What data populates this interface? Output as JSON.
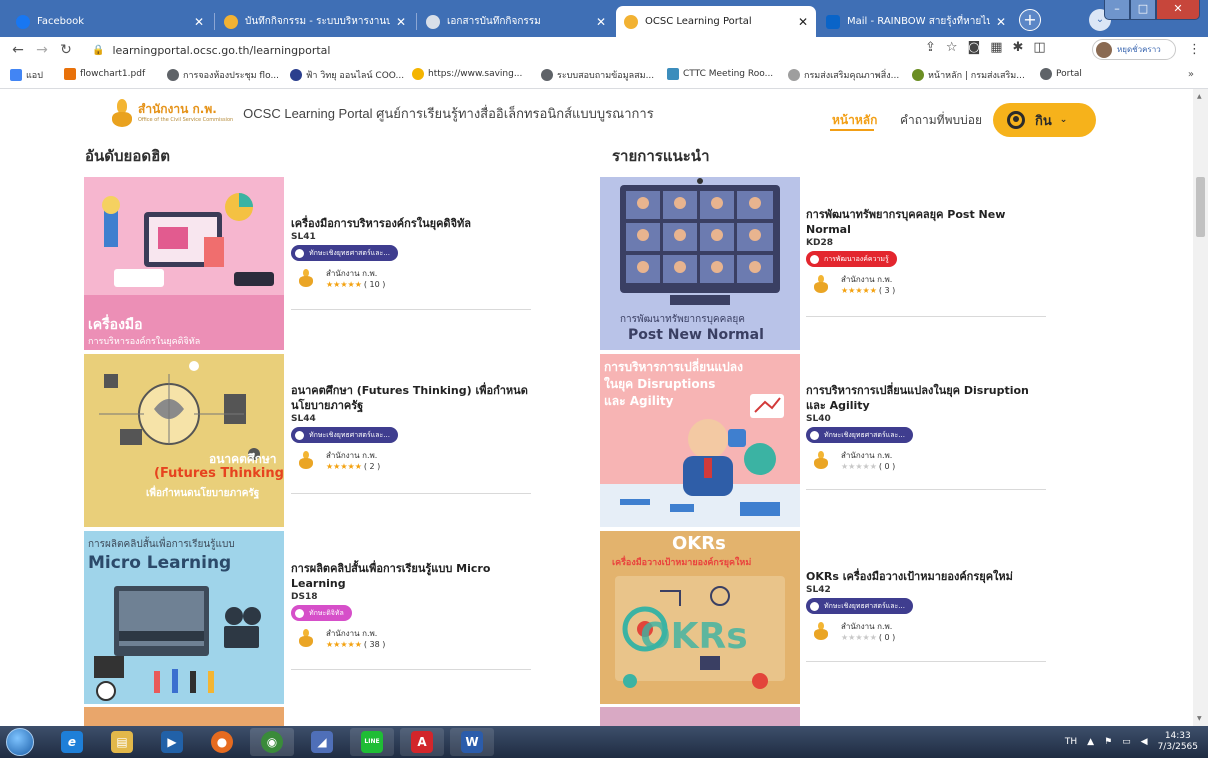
{
  "browser": {
    "tabs": [
      {
        "title": "Facebook",
        "color": "#1877f2"
      },
      {
        "title": "บันทึกกิจกรรม - ระบบบริหารงานบุคคล",
        "color": "#f2b233"
      },
      {
        "title": "เอกสารบันทึกกิจกรรม",
        "color": "#5f6368"
      },
      {
        "title": "OCSC Learning Portal",
        "color": "#f2b233"
      },
      {
        "title": "Mail - RAINBOW สายรุ้งที่หายไป - C",
        "color": "#0a64c8"
      }
    ],
    "url": "learningportal.ocsc.go.th/learningportal",
    "profile_label": "หยุดชั่วคราว",
    "bookmarks": [
      {
        "label": "แอป",
        "color": "#4285f4"
      },
      {
        "label": "flowchart1.pdf",
        "color": "#e8710a"
      },
      {
        "label": "การจองห้องประชุม flo...",
        "color": "#5f6368"
      },
      {
        "label": "ฟ้า วิทยุ ออนไลน์ COO...",
        "color": "#2b3f8e"
      },
      {
        "label": "https://www.saving...",
        "color": "#f4b400"
      },
      {
        "label": "ระบบสอบถามข้อมูลสม...",
        "color": "#5f6368"
      },
      {
        "label": "CTTC Meeting Roo...",
        "color": "#3c8dbc"
      },
      {
        "label": "กรมส่งเสริมคุณภาพสิ่ง...",
        "color": "#9e9e9e"
      },
      {
        "label": "หน้าหลัก | กรมส่งเสริม...",
        "color": "#6b8e23"
      },
      {
        "label": "Portal",
        "color": "#5f6368"
      }
    ]
  },
  "site": {
    "logo_text": "สำนักงาน ก.พ.",
    "logo_sub": "Office of the Civil Service Commission",
    "title": "OCSC Learning Portal ศูนย์การเรียนรู้ทางสื่ออิเล็กทรอนิกส์แบบบูรณาการ",
    "nav_home": "หน้าหลัก",
    "nav_faq": "คำถามที่พบบ่อย",
    "user_name": "กิน"
  },
  "sections": {
    "left_title": "อันดับยอดฮิต",
    "right_title": "รายการแนะนำ"
  },
  "left_courses": [
    {
      "title": "เครื่องมือการบริหารองค์กรในยุคดิจิทัล",
      "code": "SL41",
      "tag": "ทักษะเชิงยุทธศาสตร์และ...",
      "tag_color": "#3f3d8f",
      "org": "สำนักงาน ก.พ.",
      "rating": 5,
      "count": "( 10 )",
      "img_caption_1": "เครื่องมือ",
      "img_caption_2": "การบริหารองค์กรในยุคดิจิทัล",
      "img_bg": "#f6b6cf"
    },
    {
      "title": "อนาคตศึกษา (Futures Thinking) เพื่อกำหนดนโยบายภาครัฐ",
      "code": "SL44",
      "tag": "ทักษะเชิงยุทธศาสตร์และ...",
      "tag_color": "#3f3d8f",
      "org": "สำนักงาน ก.พ.",
      "rating": 5,
      "count": "( 2 )",
      "img_caption_1": "อนาคตศึกษา",
      "img_caption_2": "(Futures Thinking)",
      "img_caption_3": "เพื่อกำหนดนโยบายภาครัฐ",
      "img_bg": "#e9cf7a"
    },
    {
      "title": "การผลิตคลิปสั้นเพื่อการเรียนรู้แบบ Micro Learning",
      "code": "DS18",
      "tag": "ทักษะดิจิทัล",
      "tag_color": "#d64fc9",
      "org": "สำนักงาน ก.พ.",
      "rating": 5,
      "count": "( 38 )",
      "img_caption_1": "การผลิตคลิปสั้นเพื่อการเรียนรู้แบบ",
      "img_caption_2": "Micro Learning",
      "img_bg": "#9fd4ea"
    }
  ],
  "right_courses": [
    {
      "title": "การพัฒนาทรัพยากรบุคคลยุค Post New Normal",
      "code": "KD28",
      "tag": "การพัฒนาองค์ความรู้",
      "tag_color": "#e3262e",
      "org": "สำนักงาน ก.พ.",
      "rating": 5,
      "count": "( 3 )",
      "img_caption_1": "การพัฒนาทรัพยากรบุคคลยุค",
      "img_caption_2": "Post New Normal",
      "img_bg": "#b9c3e8"
    },
    {
      "title": "การบริหารการเปลี่ยนแปลงในยุค Disruption และ Agility",
      "code": "SL40",
      "tag": "ทักษะเชิงยุทธศาสตร์และ...",
      "tag_color": "#3f3d8f",
      "org": "สำนักงาน ก.พ.",
      "rating": 0,
      "count": "( 0 )",
      "img_caption_1": "การบริหารการเปลี่ยนแปลง",
      "img_caption_2": "ในยุค Disruptions",
      "img_caption_3": "และ Agility",
      "img_bg": "#f7b4b4"
    },
    {
      "title": "OKRs เครื่องมือวางเป้าหมายองค์กรยุคใหม่",
      "code": "SL42",
      "tag": "ทักษะเชิงยุทธศาสตร์และ...",
      "tag_color": "#3f3d8f",
      "org": "สำนักงาน ก.พ.",
      "rating": 0,
      "count": "( 0 )",
      "img_caption_1": "OKRs",
      "img_caption_2": "เครื่องมือวางเป้าหมายองค์กรยุคใหม่",
      "img_caption_3": "OKRs",
      "img_bg": "#e3b36d"
    }
  ],
  "taskbar": {
    "apps": [
      {
        "name": "internet-explorer",
        "color": "#1e7fd8",
        "glyph": "e"
      },
      {
        "name": "file-explorer",
        "color": "#e2b84a",
        "glyph": "▤"
      },
      {
        "name": "media-player",
        "color": "#2161a8",
        "glyph": "▶"
      },
      {
        "name": "firefox",
        "color": "#e66b1f",
        "glyph": "●"
      },
      {
        "name": "chrome",
        "color": "#3a8b3a",
        "glyph": "◉"
      },
      {
        "name": "app-blue",
        "color": "#4f6fb8",
        "glyph": "◢"
      },
      {
        "name": "line",
        "color": "#1fbd35",
        "glyph": "LINE"
      },
      {
        "name": "acrobat",
        "color": "#d2262b",
        "glyph": "A"
      },
      {
        "name": "word",
        "color": "#2b5cab",
        "glyph": "W"
      }
    ],
    "lang": "TH",
    "time": "14:33",
    "date": "7/3/2565"
  }
}
